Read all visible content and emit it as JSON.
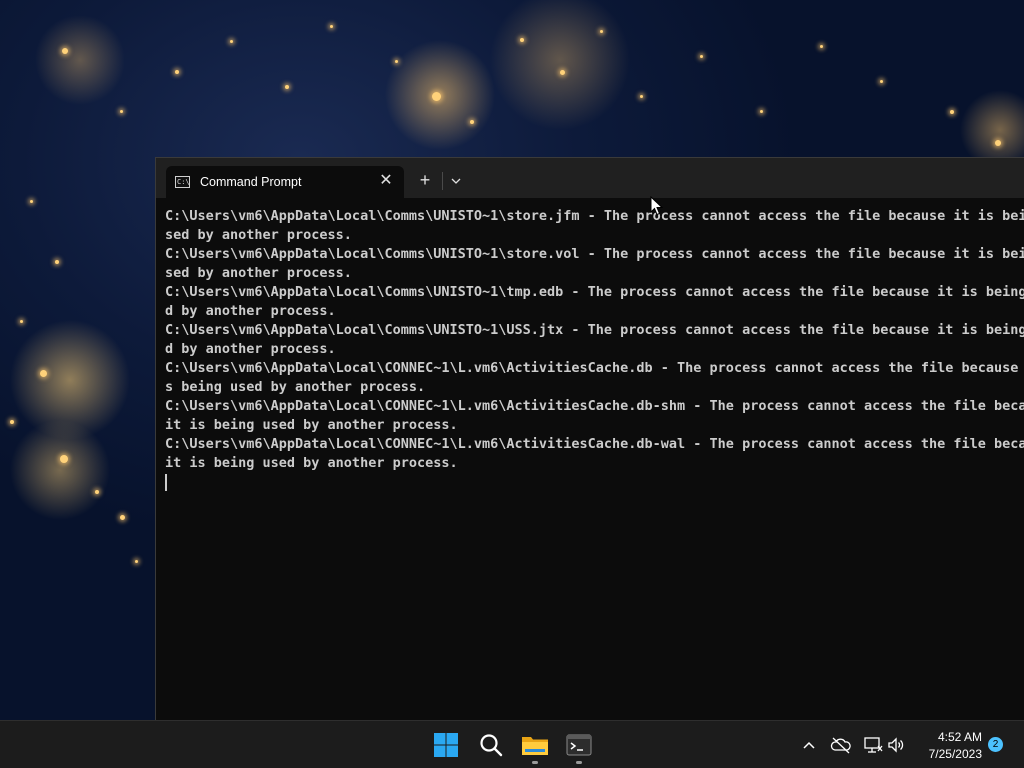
{
  "window": {
    "tab_title": "Command Prompt",
    "tab_close_label": "✕",
    "new_tab_label": "+",
    "dropdown_icon": "chevron-down-icon"
  },
  "console": {
    "lines": [
      "C:\\Users\\vm6\\AppData\\Local\\Comms\\UNISTO~1\\store.jfm - The process cannot access the file because it is being u",
      "sed by another process.",
      "C:\\Users\\vm6\\AppData\\Local\\Comms\\UNISTO~1\\store.vol - The process cannot access the file because it is being u",
      "sed by another process.",
      "C:\\Users\\vm6\\AppData\\Local\\Comms\\UNISTO~1\\tmp.edb - The process cannot access the file because it is being use",
      "d by another process.",
      "C:\\Users\\vm6\\AppData\\Local\\Comms\\UNISTO~1\\USS.jtx - The process cannot access the file because it is being use",
      "d by another process.",
      "C:\\Users\\vm6\\AppData\\Local\\CONNEC~1\\L.vm6\\ActivitiesCache.db - The process cannot access the file because it i",
      "s being used by another process.",
      "C:\\Users\\vm6\\AppData\\Local\\CONNEC~1\\L.vm6\\ActivitiesCache.db-shm - The process cannot access the file because",
      "it is being used by another process.",
      "C:\\Users\\vm6\\AppData\\Local\\CONNEC~1\\L.vm6\\ActivitiesCache.db-wal - The process cannot access the file because",
      "it is being used by another process."
    ]
  },
  "taskbar": {
    "apps": [
      {
        "name": "start-button",
        "icon": "windows-logo-icon"
      },
      {
        "name": "search-button",
        "icon": "search-icon"
      },
      {
        "name": "file-explorer-button",
        "icon": "folder-icon",
        "running": true
      },
      {
        "name": "terminal-button",
        "icon": "terminal-icon",
        "running": true
      }
    ],
    "tray": {
      "chevron_icon": "chevron-up-icon",
      "network_offline_icon": "cloud-offline-icon",
      "network_icon": "network-icon",
      "volume_icon": "speaker-icon"
    },
    "clock": {
      "time": "4:52 AM",
      "date": "7/25/2023"
    },
    "notification_count": "2"
  },
  "colors": {
    "accent": "#4cc2ff",
    "console_bg": "#0c0c0c",
    "console_text": "#cccccc",
    "titlebar_bg": "#202020",
    "taskbar_bg": "#1c1c1c"
  }
}
